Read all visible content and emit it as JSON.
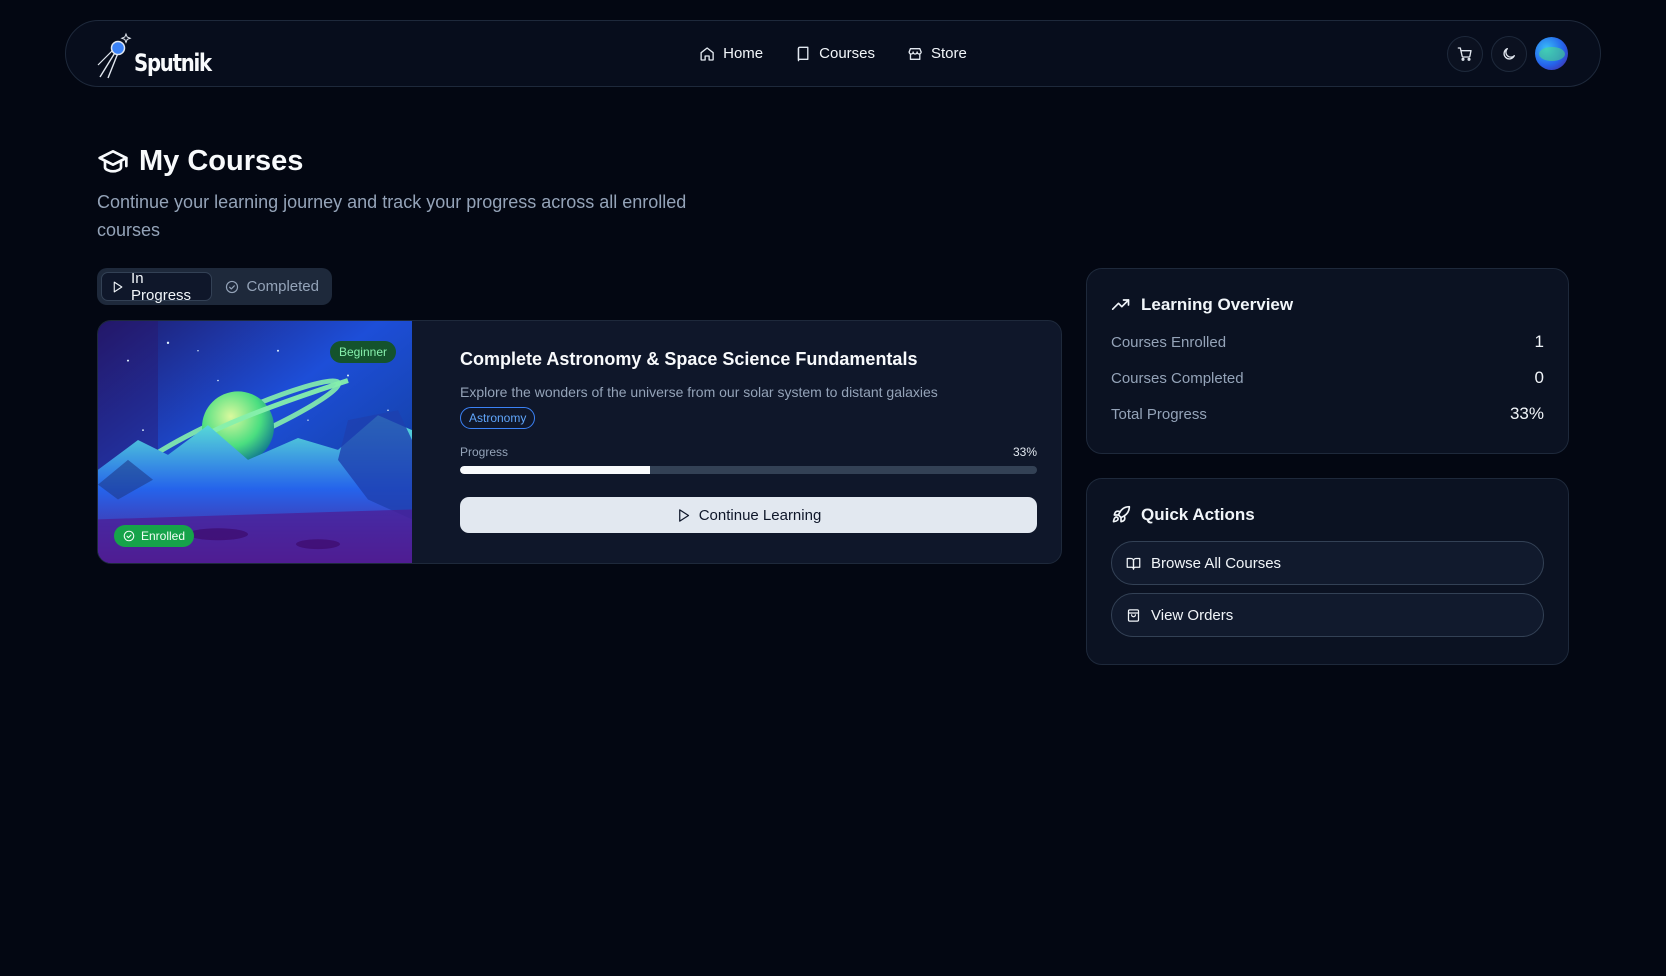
{
  "brand": {
    "name": "Sputnik"
  },
  "nav": {
    "links": [
      {
        "label": "Home",
        "icon": "home-icon"
      },
      {
        "label": "Courses",
        "icon": "book-icon"
      },
      {
        "label": "Store",
        "icon": "store-icon"
      }
    ],
    "actions": [
      "cart-icon",
      "moon-icon",
      "avatar"
    ]
  },
  "header": {
    "title": "My Courses",
    "subtitle": "Continue your learning journey and track your progress across all enrolled courses"
  },
  "tabs": [
    {
      "label": "In Progress",
      "active": true
    },
    {
      "label": "Completed",
      "active": false
    }
  ],
  "course": {
    "level": "Beginner",
    "enrolled_label": "Enrolled",
    "title": "Complete Astronomy & Space Science Fundamentals",
    "description": "Explore the wonders of the universe from our solar system to distant galaxies",
    "tag": "Astronomy",
    "progress_label": "Progress",
    "progress_text": "33%",
    "progress_fraction": 0.33,
    "button_label": "Continue Learning"
  },
  "overview": {
    "title": "Learning Overview",
    "stats": [
      {
        "label": "Courses Enrolled",
        "value": "1"
      },
      {
        "label": "Courses Completed",
        "value": "0"
      },
      {
        "label": "Total Progress",
        "value": "33%"
      }
    ]
  },
  "quick_actions": {
    "title": "Quick Actions",
    "items": [
      {
        "label": "Browse All Courses",
        "icon": "book-open-icon"
      },
      {
        "label": "View Orders",
        "icon": "shopping-bag-icon"
      }
    ]
  },
  "colors": {
    "background": "#030712",
    "card": "#0f172a",
    "border": "#1e293b",
    "accent_green": "#16a34a",
    "accent_blue": "#3b82f6"
  }
}
